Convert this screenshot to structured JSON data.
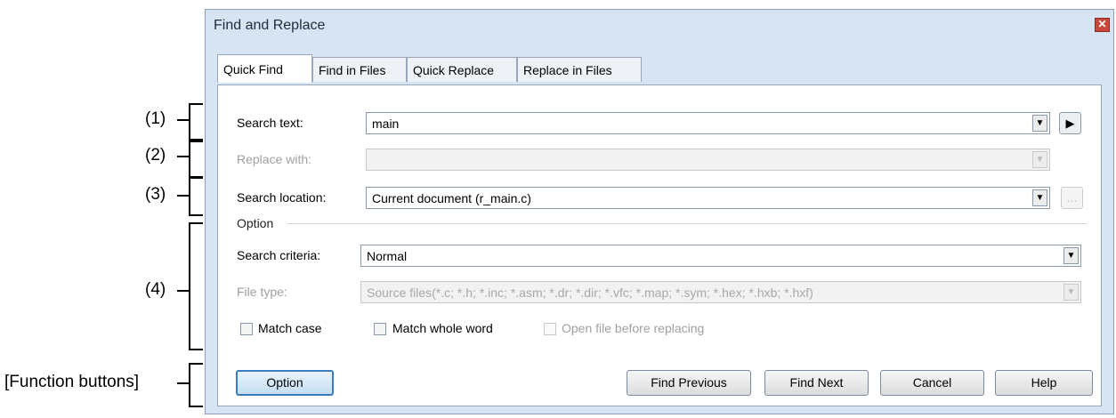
{
  "annotations": {
    "c1": "(1)",
    "c2": "(2)",
    "c3": "(3)",
    "c4": "(4)",
    "c5": "[Function buttons]"
  },
  "dialog": {
    "title": "Find and Replace",
    "close_icon": "close-icon",
    "tabs": [
      {
        "label": "Quick Find",
        "active": true
      },
      {
        "label": "Find in Files",
        "active": false
      },
      {
        "label": "Quick Replace",
        "active": false
      },
      {
        "label": "Replace in Files",
        "active": false
      }
    ],
    "search_text": {
      "label": "Search text:",
      "value": "main"
    },
    "replace_with": {
      "label": "Replace with:",
      "value": "",
      "enabled": false
    },
    "search_location": {
      "label": "Search location:",
      "value": "Current document (r_main.c)"
    },
    "option_group": {
      "title": "Option",
      "criteria": {
        "label": "Search criteria:",
        "value": "Normal"
      },
      "file_type": {
        "label": "File type:",
        "value": "Source files(*.c; *.h; *.inc; *.asm; *.dr; *.dir; *.vfc; *.map; *.sym; *.hex; *.hxb; *.hxf)",
        "enabled": false
      },
      "match_case": {
        "label": "Match case",
        "checked": false
      },
      "match_whole_word": {
        "label": "Match whole word",
        "checked": false
      },
      "open_file": {
        "label": "Open file before replacing",
        "checked": false,
        "enabled": false
      }
    },
    "buttons": {
      "option": "Option",
      "find_previous": "Find Previous",
      "find_next": "Find Next",
      "cancel": "Cancel",
      "help": "Help"
    },
    "icons": {
      "arrow": "play-arrow-icon",
      "browse": "ellipsis-icon"
    }
  }
}
